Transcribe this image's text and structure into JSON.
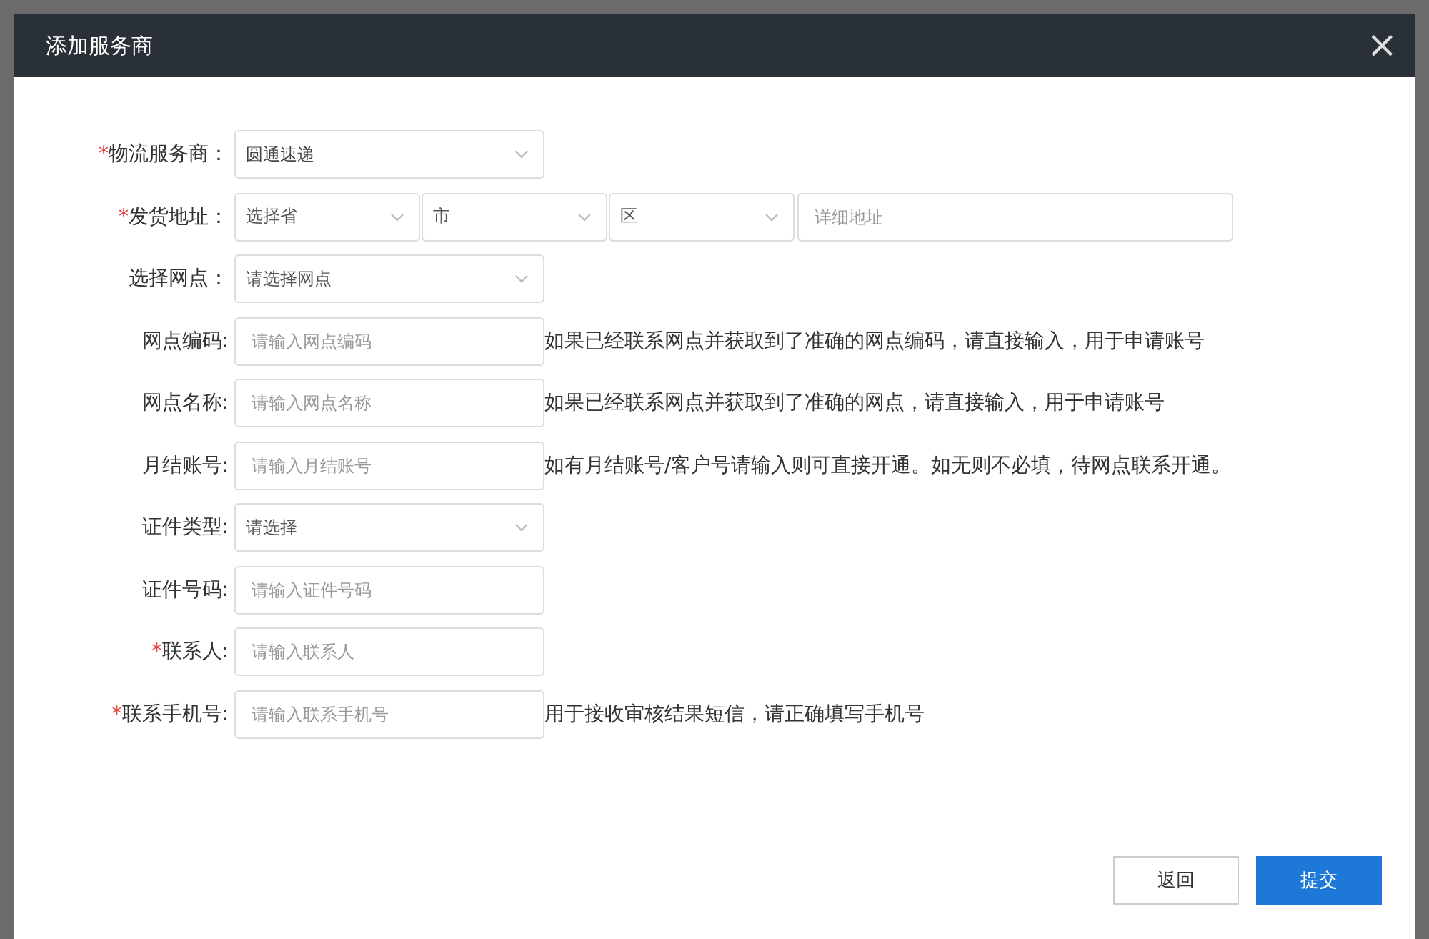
{
  "dialog": {
    "title": "添加服务商",
    "close": "×"
  },
  "fields": [
    {
      "kind": "select",
      "required_mark": "*",
      "label": "物流服务商：",
      "value": "圆通速递"
    },
    {
      "kind": "address",
      "required_mark": "*",
      "label": "发货地址：",
      "parts": [
        {
          "kind": "select",
          "placeholder": "选择省"
        },
        {
          "kind": "select",
          "placeholder": "市"
        },
        {
          "kind": "select",
          "placeholder": "区"
        },
        {
          "kind": "input",
          "placeholder": "详细地址"
        }
      ]
    },
    {
      "kind": "select",
      "label": "选择网点：",
      "placeholder": "请选择网点"
    },
    {
      "kind": "input",
      "label": "网点编码:",
      "placeholder": "请输入网点编码",
      "hint": "如果已经联系网点并获取到了准确的网点编码，请直接输入，用于申请账号"
    },
    {
      "kind": "input",
      "label": "网点名称:",
      "placeholder": "请输入网点名称",
      "hint": "如果已经联系网点并获取到了准确的网点，请直接输入，用于申请账号"
    },
    {
      "kind": "input",
      "label": "月结账号:",
      "placeholder": "请输入月结账号",
      "hint": "如有月结账号/客户号请输入则可直接开通。如无则不必填，待网点联系开通。"
    },
    {
      "kind": "select",
      "label": "证件类型:",
      "placeholder": "请选择"
    },
    {
      "kind": "input",
      "label": "证件号码:",
      "placeholder": "请输入证件号码"
    },
    {
      "kind": "input",
      "required_mark": "*",
      "label": "联系人:",
      "placeholder": "请输入联系人"
    },
    {
      "kind": "input",
      "required_mark": "*",
      "label": "联系手机号:",
      "placeholder": "请输入联系手机号",
      "hint": "用于接收审核结果短信，请正确填写手机号"
    }
  ],
  "buttons": [
    {
      "kind": "secondary",
      "label": "返回"
    },
    {
      "kind": "primary",
      "label": "提交"
    }
  ]
}
